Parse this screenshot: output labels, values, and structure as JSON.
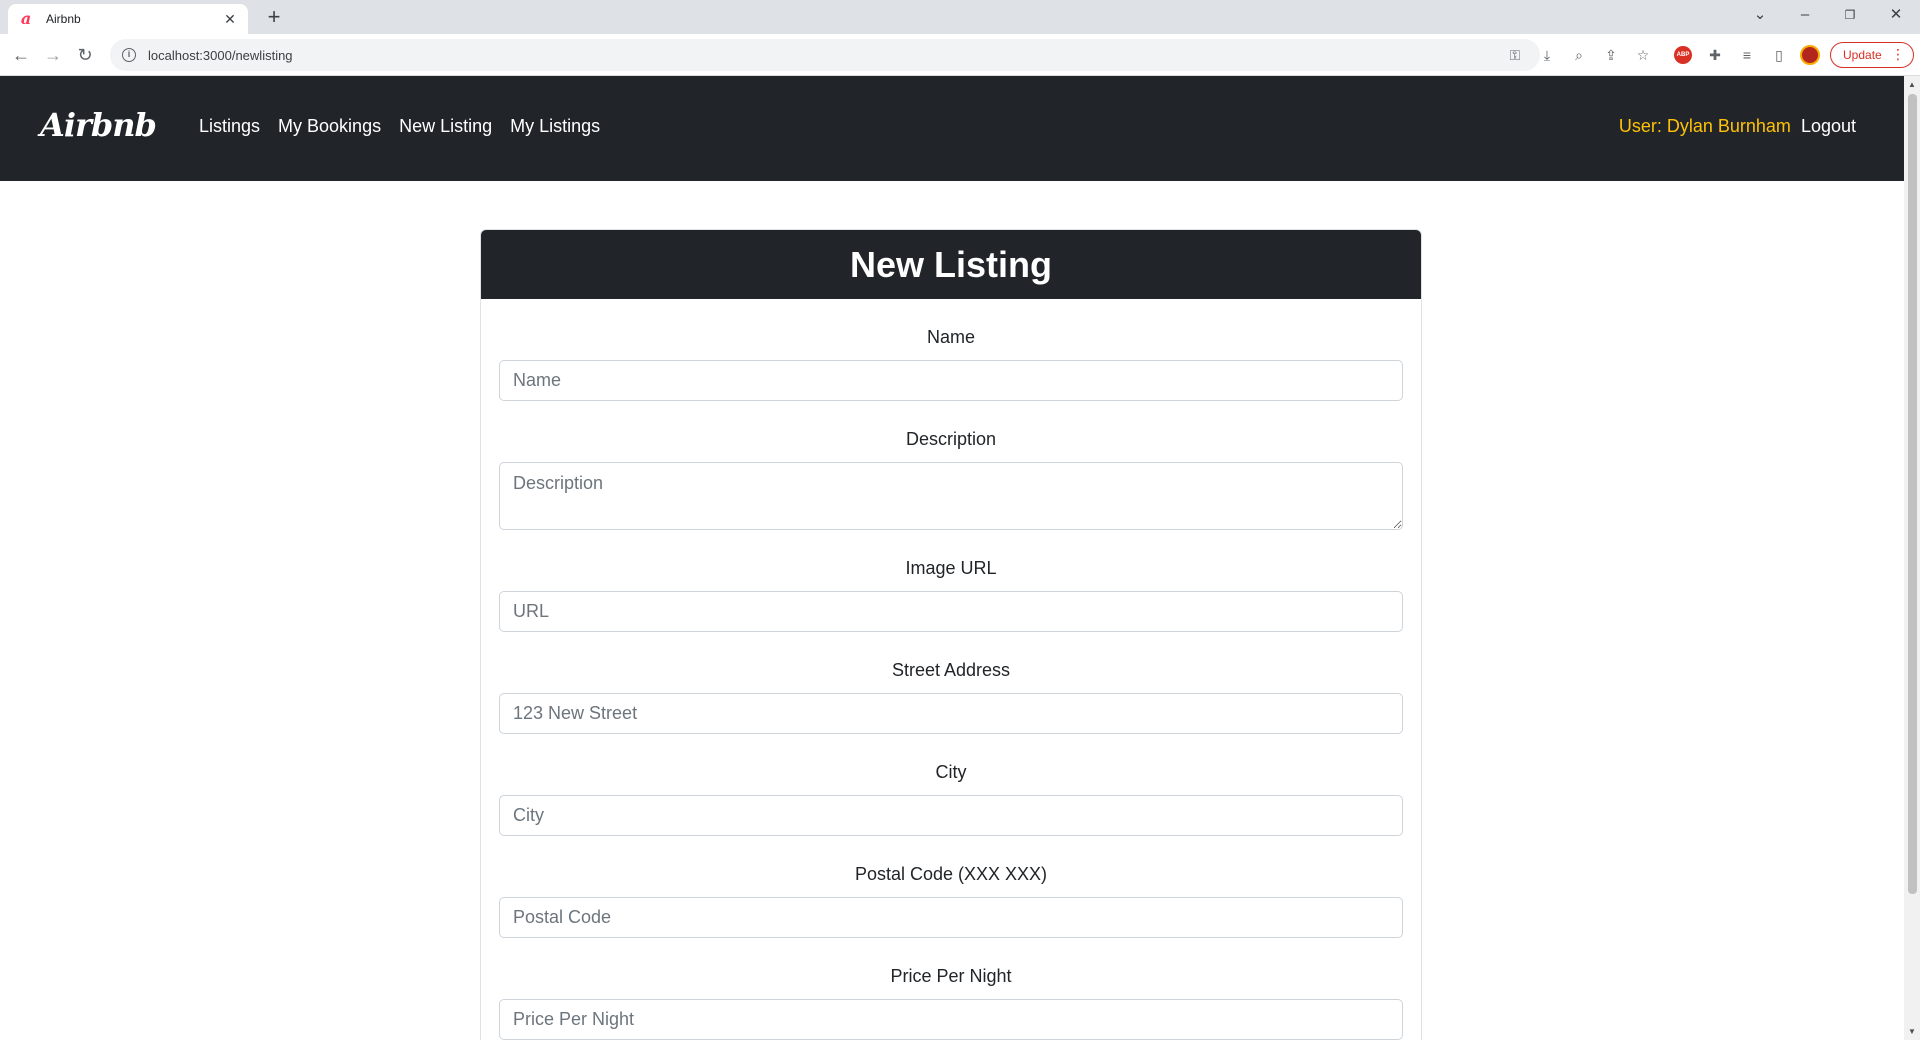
{
  "browser": {
    "tab_title": "Airbnb",
    "tab_favicon": "a",
    "url": "localhost:3000/newlisting",
    "update_label": "Update"
  },
  "navbar": {
    "brand": "Airbnb",
    "links": [
      "Listings",
      "My Bookings",
      "New Listing",
      "My Listings"
    ],
    "user_label": "User: Dylan Burnham",
    "logout_label": "Logout",
    "user_color": "#ffc107",
    "background": "#212529"
  },
  "form": {
    "title": "New Listing",
    "fields": [
      {
        "label": "Name",
        "placeholder": "Name",
        "value": ""
      },
      {
        "label": "Description",
        "placeholder": "Description",
        "value": ""
      },
      {
        "label": "Image URL",
        "placeholder": "URL",
        "value": ""
      },
      {
        "label": "Street Address",
        "placeholder": "123 New Street",
        "value": ""
      },
      {
        "label": "City",
        "placeholder": "City",
        "value": ""
      },
      {
        "label": "Postal Code (XXX XXX)",
        "placeholder": "Postal Code",
        "value": ""
      },
      {
        "label": "Price Per Night",
        "placeholder": "Price Per Night",
        "value": ""
      }
    ]
  },
  "icons": {
    "back": "arrow-left-icon",
    "forward": "arrow-right-icon",
    "reload": "reload-icon",
    "site_info": "info-icon",
    "password": "key-icon",
    "install": "download-icon",
    "zoom": "zoom-icon",
    "share": "share-icon",
    "bookmark": "star-icon",
    "adblock": "adblock-icon",
    "extensions": "puzzle-icon",
    "reading_list": "reading-list-icon",
    "side_panel": "side-panel-icon",
    "profile": "avatar-icon"
  }
}
